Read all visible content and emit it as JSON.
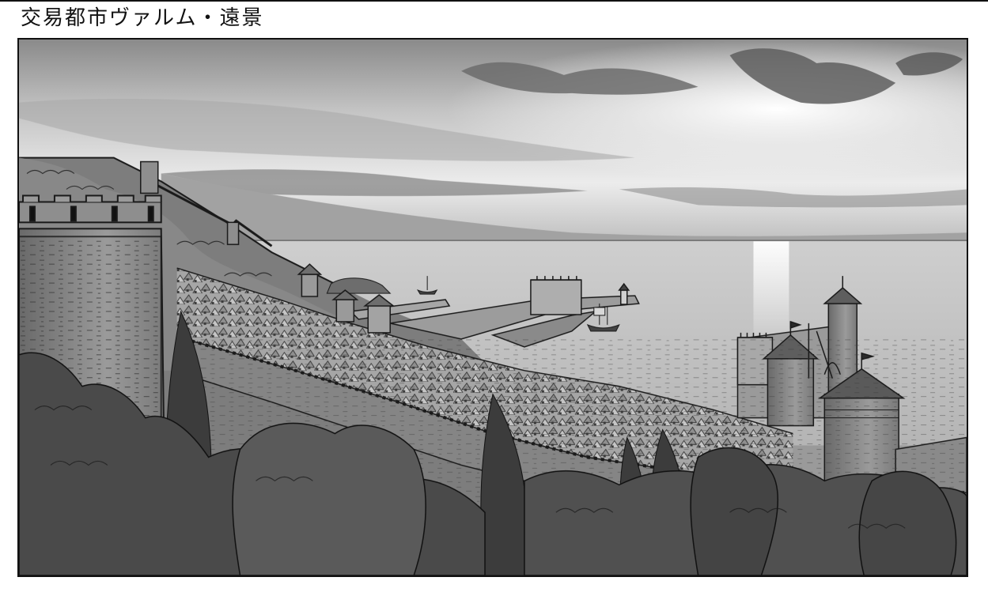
{
  "header": {
    "title": "交易都市ヴァルム・遠景"
  },
  "illustration": {
    "style": "grayscale",
    "colors": {
      "sky_top": "#8e8e8e",
      "sky_glow": "#f2f2f2",
      "sea": "#d6d6d6",
      "foliage_dark": "#3c3c3c",
      "stone": "#8a8a8a",
      "line": "#1a1a1a"
    }
  }
}
